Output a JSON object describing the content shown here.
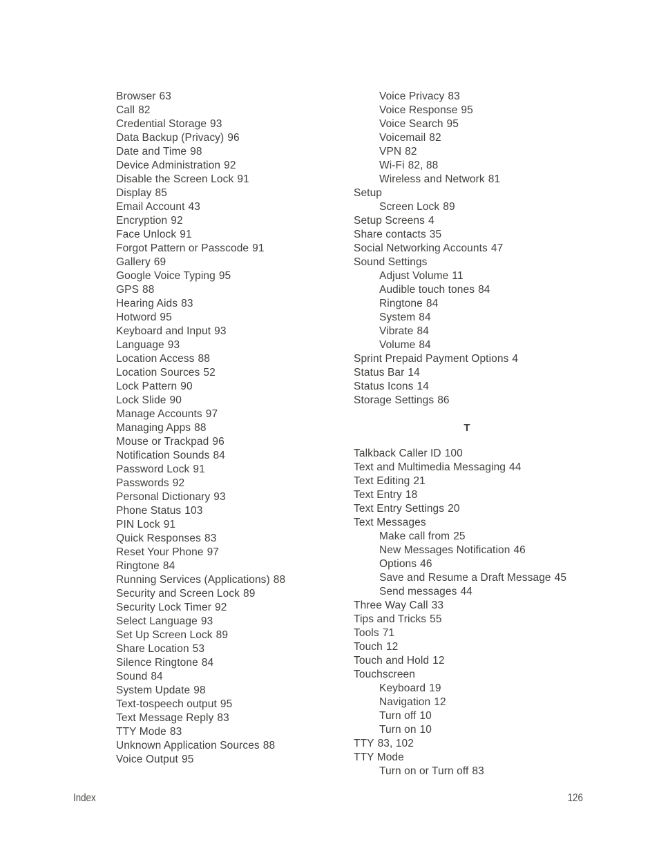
{
  "document": {
    "footer_label": "Index",
    "page_number": "126"
  },
  "index": {
    "left_column": [
      {
        "level": 1,
        "label": "Browser",
        "page": "63"
      },
      {
        "level": 1,
        "label": "Call",
        "page": "82"
      },
      {
        "level": 1,
        "label": "Credential Storage",
        "page": "93"
      },
      {
        "level": 1,
        "label": "Data Backup (Privacy)",
        "page": "96"
      },
      {
        "level": 1,
        "label": "Date and Time",
        "page": "98"
      },
      {
        "level": 1,
        "label": "Device Administration",
        "page": "92"
      },
      {
        "level": 1,
        "label": "Disable the Screen Lock",
        "page": "91"
      },
      {
        "level": 1,
        "label": "Display",
        "page": "85"
      },
      {
        "level": 1,
        "label": "Email Account",
        "page": "43"
      },
      {
        "level": 1,
        "label": "Encryption",
        "page": "92"
      },
      {
        "level": 1,
        "label": "Face Unlock",
        "page": "91"
      },
      {
        "level": 1,
        "label": "Forgot Pattern or Passcode",
        "page": "91"
      },
      {
        "level": 1,
        "label": "Gallery",
        "page": "69"
      },
      {
        "level": 1,
        "label": "Google Voice Typing",
        "page": "95"
      },
      {
        "level": 1,
        "label": "GPS",
        "page": "88"
      },
      {
        "level": 1,
        "label": "Hearing Aids",
        "page": "83"
      },
      {
        "level": 1,
        "label": "Hotword",
        "page": "95"
      },
      {
        "level": 1,
        "label": "Keyboard and Input",
        "page": "93"
      },
      {
        "level": 1,
        "label": "Language",
        "page": "93"
      },
      {
        "level": 1,
        "label": "Location Access",
        "page": "88"
      },
      {
        "level": 1,
        "label": "Location Sources",
        "page": "52"
      },
      {
        "level": 1,
        "label": "Lock Pattern",
        "page": "90"
      },
      {
        "level": 1,
        "label": "Lock Slide",
        "page": "90"
      },
      {
        "level": 1,
        "label": "Manage Accounts",
        "page": "97"
      },
      {
        "level": 1,
        "label": "Managing Apps",
        "page": "88"
      },
      {
        "level": 1,
        "label": "Mouse or Trackpad",
        "page": "96"
      },
      {
        "level": 1,
        "label": "Notification Sounds",
        "page": "84"
      },
      {
        "level": 1,
        "label": "Password Lock",
        "page": "91"
      },
      {
        "level": 1,
        "label": "Passwords",
        "page": "92"
      },
      {
        "level": 1,
        "label": "Personal Dictionary",
        "page": "93"
      },
      {
        "level": 1,
        "label": "Phone Status",
        "page": "103"
      },
      {
        "level": 1,
        "label": "PIN Lock",
        "page": "91"
      },
      {
        "level": 1,
        "label": "Quick Responses",
        "page": "83"
      },
      {
        "level": 1,
        "label": "Reset Your Phone",
        "page": "97"
      },
      {
        "level": 1,
        "label": "Ringtone",
        "page": "84"
      },
      {
        "level": 1,
        "label": "Running Services (Applications)",
        "page": "88"
      },
      {
        "level": 1,
        "label": "Security and Screen Lock",
        "page": "89"
      },
      {
        "level": 1,
        "label": "Security Lock Timer",
        "page": "92"
      },
      {
        "level": 1,
        "label": "Select Language",
        "page": "93"
      },
      {
        "level": 1,
        "label": "Set Up Screen Lock",
        "page": "89"
      },
      {
        "level": 1,
        "label": "Share Location",
        "page": "53"
      },
      {
        "level": 1,
        "label": "Silence Ringtone",
        "page": "84"
      },
      {
        "level": 1,
        "label": "Sound",
        "page": "84"
      },
      {
        "level": 1,
        "label": "System Update",
        "page": "98"
      },
      {
        "level": 1,
        "label": "Text-tospeech output",
        "page": "95"
      },
      {
        "level": 1,
        "label": "Text Message Reply",
        "page": "83"
      },
      {
        "level": 1,
        "label": "TTY Mode",
        "page": "83"
      },
      {
        "level": 1,
        "label": "Unknown Application Sources",
        "page": "88"
      },
      {
        "level": 1,
        "label": "Voice Output",
        "page": "95"
      }
    ],
    "right_column_part1": [
      {
        "level": 2,
        "label": "Voice Privacy",
        "page": "83"
      },
      {
        "level": 2,
        "label": "Voice Response",
        "page": "95"
      },
      {
        "level": 2,
        "label": "Voice Search",
        "page": "95"
      },
      {
        "level": 2,
        "label": "Voicemail",
        "page": "82"
      },
      {
        "level": 2,
        "label": "VPN",
        "page": "82"
      },
      {
        "level": 2,
        "label": "Wi-Fi",
        "page": "82, 88"
      },
      {
        "level": 2,
        "label": "Wireless and Network",
        "page": "81"
      },
      {
        "level": 1,
        "label": "Setup",
        "page": ""
      },
      {
        "level": 2,
        "label": "Screen Lock",
        "page": "89"
      },
      {
        "level": 1,
        "label": "Setup Screens",
        "page": "4"
      },
      {
        "level": 1,
        "label": "Share contacts",
        "page": "35"
      },
      {
        "level": 1,
        "label": "Social Networking Accounts",
        "page": "47"
      },
      {
        "level": 1,
        "label": "Sound Settings",
        "page": ""
      },
      {
        "level": 2,
        "label": "Adjust Volume",
        "page": "11"
      },
      {
        "level": 2,
        "label": "Audible touch tones",
        "page": "84"
      },
      {
        "level": 2,
        "label": "Ringtone",
        "page": "84"
      },
      {
        "level": 2,
        "label": "System",
        "page": "84"
      },
      {
        "level": 2,
        "label": "Vibrate",
        "page": "84"
      },
      {
        "level": 2,
        "label": "Volume",
        "page": "84"
      },
      {
        "level": 1,
        "label": "Sprint Prepaid Payment Options",
        "page": "4"
      },
      {
        "level": 1,
        "label": "Status Bar",
        "page": "14"
      },
      {
        "level": 1,
        "label": "Status Icons",
        "page": "14"
      },
      {
        "level": 1,
        "label": "Storage Settings",
        "page": "86"
      }
    ],
    "section_letter": "T",
    "right_column_part2": [
      {
        "level": 1,
        "label": "Talkback Caller ID",
        "page": "100"
      },
      {
        "level": 1,
        "label": "Text and Multimedia Messaging",
        "page": "44"
      },
      {
        "level": 1,
        "label": "Text Editing",
        "page": "21"
      },
      {
        "level": 1,
        "label": "Text Entry",
        "page": "18"
      },
      {
        "level": 1,
        "label": "Text Entry Settings",
        "page": "20"
      },
      {
        "level": 1,
        "label": "Text Messages",
        "page": ""
      },
      {
        "level": 2,
        "label": "Make call from",
        "page": "25"
      },
      {
        "level": 2,
        "label": "New Messages Notification",
        "page": "46"
      },
      {
        "level": 2,
        "label": "Options",
        "page": "46"
      },
      {
        "level": 2,
        "label": "Save and Resume a Draft Message",
        "page": "45"
      },
      {
        "level": 2,
        "label": "Send messages",
        "page": "44"
      },
      {
        "level": 1,
        "label": "Three Way Call",
        "page": "33"
      },
      {
        "level": 1,
        "label": "Tips and Tricks",
        "page": "55"
      },
      {
        "level": 1,
        "label": "Tools",
        "page": "71"
      },
      {
        "level": 1,
        "label": "Touch",
        "page": "12"
      },
      {
        "level": 1,
        "label": "Touch and Hold",
        "page": "12"
      },
      {
        "level": 1,
        "label": "Touchscreen",
        "page": ""
      },
      {
        "level": 2,
        "label": "Keyboard",
        "page": "19"
      },
      {
        "level": 2,
        "label": "Navigation",
        "page": "12"
      },
      {
        "level": 2,
        "label": "Turn off",
        "page": "10"
      },
      {
        "level": 2,
        "label": "Turn on",
        "page": "10"
      },
      {
        "level": 1,
        "label": "TTY",
        "page": "83, 102"
      },
      {
        "level": 1,
        "label": "TTY Mode",
        "page": ""
      },
      {
        "level": 2,
        "label": "Turn on or Turn off",
        "page": "83"
      }
    ]
  }
}
